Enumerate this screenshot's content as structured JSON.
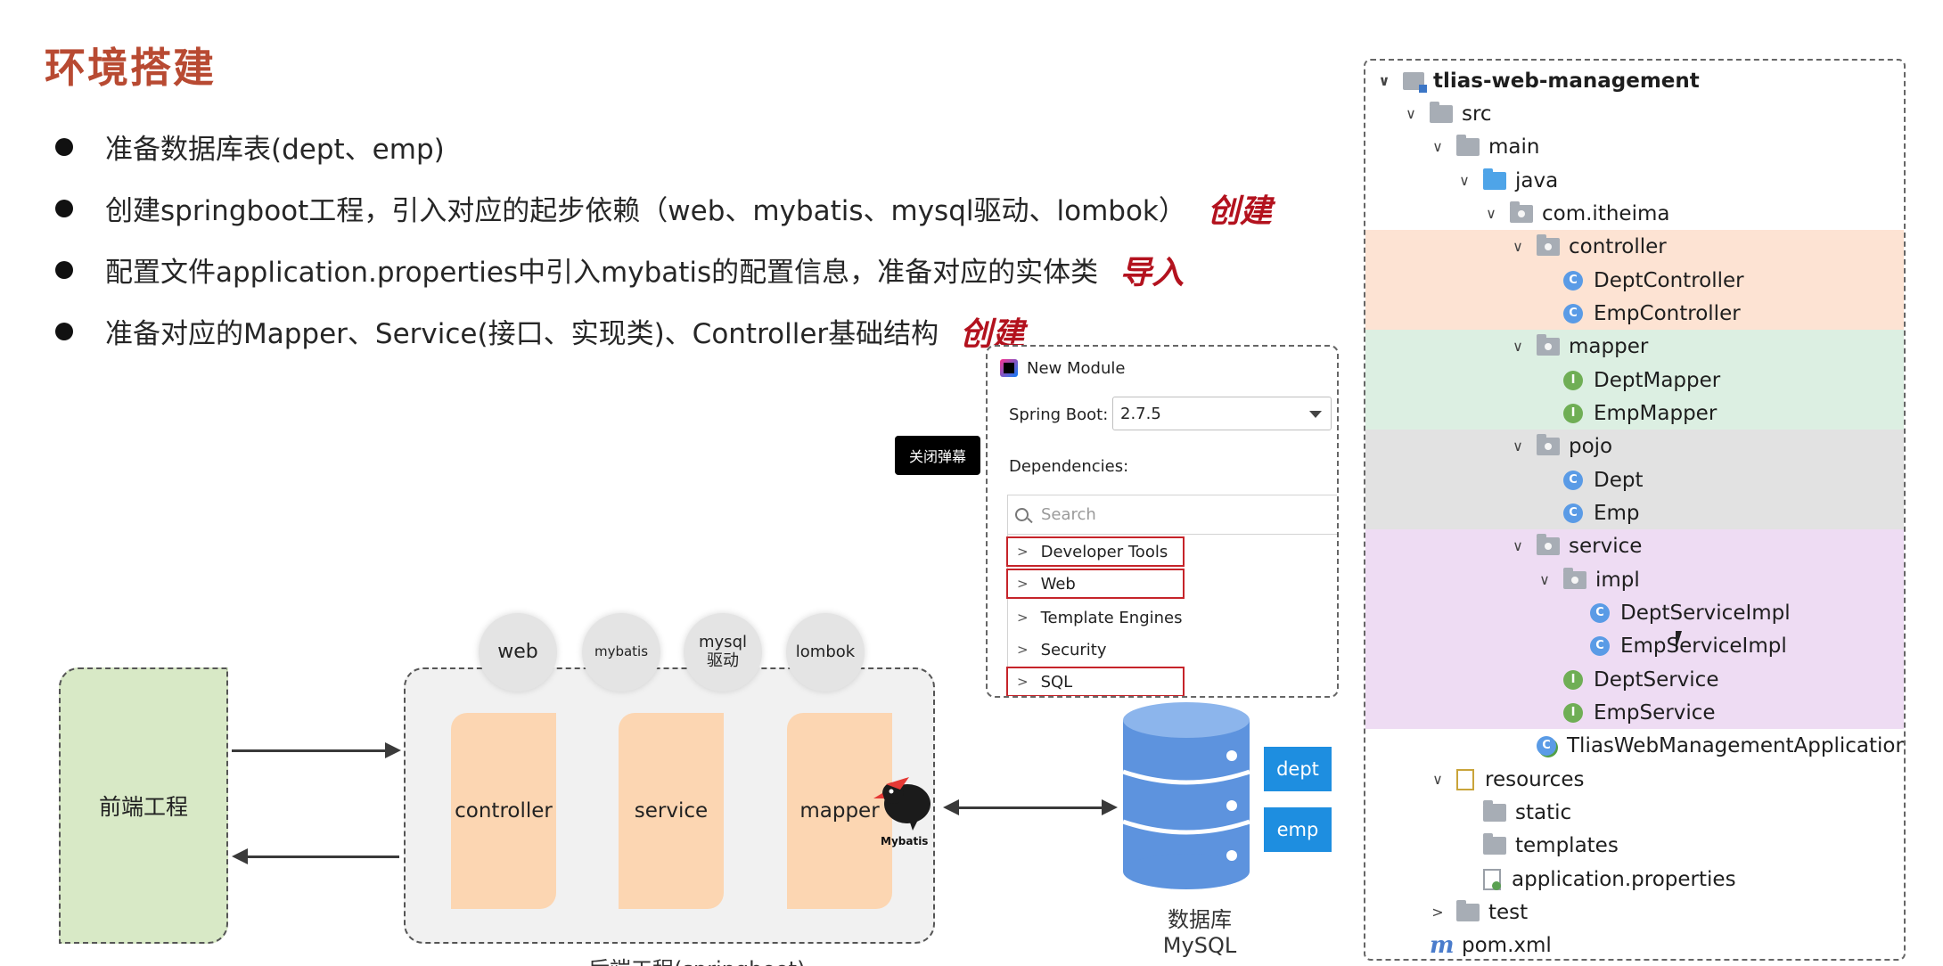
{
  "title": "环境搭建",
  "bullets": [
    {
      "text": "准备数据库表(dept、emp)",
      "note": ""
    },
    {
      "text": "创建springboot工程，引入对应的起步依赖（web、mybatis、mysql驱动、lombok）",
      "note": "创建"
    },
    {
      "text": "配置文件application.properties中引入mybatis的配置信息，准备对应的实体类",
      "note": "导入"
    },
    {
      "text": "准备对应的Mapper、Service(接口、实现类)、Controller基础结构",
      "note": "创建"
    }
  ],
  "diagram": {
    "frontend": "前端工程",
    "backend_caption": "后端工程(springboot)",
    "layers": [
      "controller",
      "service",
      "mapper"
    ],
    "deps": [
      "web",
      "mybatis",
      "mysql\n驱动",
      "lombok"
    ],
    "mybatis_logo_text": "Mybatis",
    "db_tables": [
      "dept",
      "emp"
    ],
    "db_label_line1": "数据库",
    "db_label_line2": "MySQL"
  },
  "close_danmaku": "关闭弹幕",
  "dialog": {
    "title": "New Module",
    "spring_boot_label": "Spring Boot:",
    "spring_boot_version": "2.7.5",
    "dependencies_label": "Dependencies:",
    "search_placeholder": "Search",
    "items": [
      "Developer Tools",
      "Web",
      "Template Engines",
      "Security",
      "SQL"
    ]
  },
  "tree": {
    "rows": [
      {
        "label": "tlias-web-management",
        "bold": true
      },
      {
        "label": "src"
      },
      {
        "label": "main"
      },
      {
        "label": "java"
      },
      {
        "label": "com.itheima"
      },
      {
        "label": "controller"
      },
      {
        "label": "DeptController"
      },
      {
        "label": "EmpController"
      },
      {
        "label": "mapper"
      },
      {
        "label": "DeptMapper"
      },
      {
        "label": "EmpMapper"
      },
      {
        "label": "pojo"
      },
      {
        "label": "Dept"
      },
      {
        "label": "Emp"
      },
      {
        "label": "service"
      },
      {
        "label": "impl"
      },
      {
        "label": "DeptServiceImpl"
      },
      {
        "label": "EmpServiceImpl"
      },
      {
        "label": "DeptService"
      },
      {
        "label": "EmpService"
      },
      {
        "label": "TliasWebManagementApplication"
      },
      {
        "label": "resources"
      },
      {
        "label": "static"
      },
      {
        "label": "templates"
      },
      {
        "label": "application.properties"
      },
      {
        "label": "test"
      },
      {
        "label": "pom.xml"
      }
    ],
    "band_colors": {
      "controller": "#fde3d3",
      "mapper": "#dcefe2",
      "pojo": "#e2e2e2",
      "service": "#eedcf3"
    }
  }
}
